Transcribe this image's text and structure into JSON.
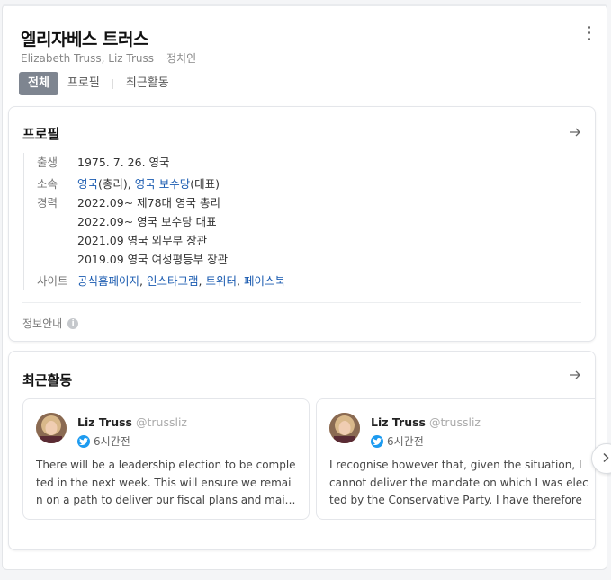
{
  "header": {
    "title": "엘리자베스 트러스",
    "subtitle": "Elizabeth Truss, Liz Truss",
    "category": "정치인"
  },
  "tabs": [
    {
      "label": "전체",
      "active": true
    },
    {
      "label": "프로필",
      "active": false
    },
    {
      "label": "최근활동",
      "active": false
    }
  ],
  "profile": {
    "title": "프로필",
    "birth": {
      "label": "출생",
      "value": "1975. 7. 26. 영국"
    },
    "affiliation": {
      "label": "소속",
      "part1_link": "영국",
      "part1_suffix": "(총리),",
      "part2_link": "영국 보수당",
      "part2_suffix": "(대표)"
    },
    "career": {
      "label": "경력",
      "items": [
        "2022.09~ 제78대 영국 총리",
        "2022.09~ 영국 보수당 대표",
        "2021.09 영국 외무부 장관",
        "2019.09 영국 여성평등부 장관"
      ]
    },
    "sites": {
      "label": "사이트",
      "links": [
        "공식홈페이지",
        "인스타그램",
        "트위터",
        "페이스북"
      ],
      "separator": ","
    },
    "info_label": "정보안내"
  },
  "activity": {
    "title": "최근활동",
    "tweets": [
      {
        "name": "Liz Truss",
        "handle": "@trussliz",
        "time": "6시간전",
        "text": "There will be a leadership election to be completed in the next week. This will ensure we remain on a path to deliver our fiscal plans and mai…"
      },
      {
        "name": "Liz Truss",
        "handle": "@trussliz",
        "time": "6시간전",
        "text": "I recognise however that, given the situation, I cannot deliver the mandate on which I was elected by the Conservative Party. I have therefore …"
      }
    ]
  },
  "colors": {
    "link": "#1a5bb0",
    "twitter": "#1d9bf0",
    "tab_active": "#7e8590"
  }
}
